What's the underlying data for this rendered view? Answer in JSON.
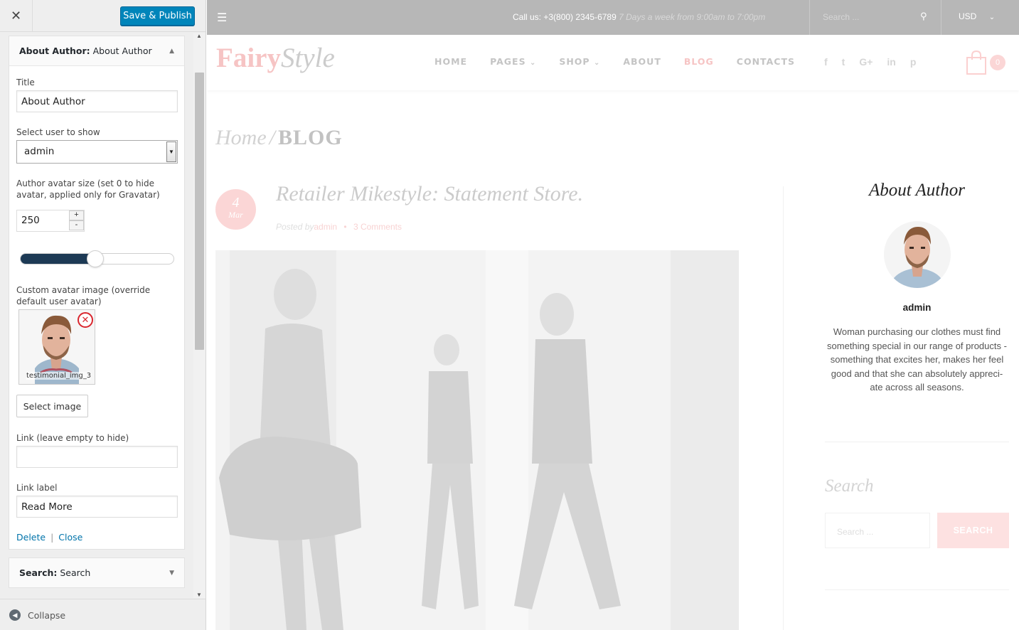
{
  "customizer": {
    "close_icon": "close-icon",
    "publish_label": "Save & Publish",
    "widget_author": {
      "title_bold": "About Author:",
      "title_rest": " About Author",
      "title_field_label": "Title",
      "title_field_value": "About Author",
      "user_label": "Select user to show",
      "user_value": "admin",
      "avatar_size_label": "Author avatar size (set 0 to hide avatar, applied only for Gravatar)",
      "avatar_size_value": "250",
      "stepper_plus": "+",
      "stepper_minus": "-",
      "slider_level": 0.42,
      "custom_avatar_label": "Custom avatar image (override default user avatar)",
      "image_filename": "testimonial_img_3",
      "select_image_label": "Select image",
      "link_label": "Link (leave empty to hide)",
      "link_value": "",
      "link_label_label": "Link label",
      "link_label_value": "Read More",
      "delete_label": "Delete",
      "separator": "|",
      "close_label": "Close"
    },
    "widget_search": {
      "title_bold": "Search:",
      "title_rest": " Search"
    },
    "collapse_label": "Collapse"
  },
  "site": {
    "call_us": "Call us: +3(800) 2345-6789",
    "hours": "7 Days a week from 9:00am to 7:00pm",
    "search_placeholder": "Search ...",
    "currency": "USD",
    "logo_part1": "Fairy",
    "logo_part2": "Style",
    "nav": [
      "HOME",
      "PAGES",
      "SHOP",
      "ABOUT",
      "BLOG",
      "CONTACTS"
    ],
    "nav_dropdown_marker": "⌄",
    "social": [
      "f",
      "t",
      "G+",
      "in",
      "p"
    ],
    "cart_count": "0",
    "breadcrumb_home": "Home",
    "breadcrumb_sep": "/",
    "breadcrumb_current": "BLOG",
    "post": {
      "day": "4",
      "month": "Mar",
      "title": "Retailer Mikestyle: Statement Store.",
      "posted_by": "Posted by",
      "author": "admin",
      "bullet": "•",
      "comments": "3 Comments"
    },
    "about_author": {
      "title": "About Author",
      "name": "admin",
      "bio": "Woman purchasing our clothes must find something special in our range of products - something that excites her, makes her feel good and that she can absolutely appreci-ate across all seasons."
    },
    "search_widget": {
      "title": "Search",
      "placeholder": "Search ...",
      "button": "SEARCH"
    }
  },
  "colors": {
    "publish_blue": "#0085ba",
    "brand_pink": "#f6c4c4",
    "topbar_gray": "#b7b7b7"
  }
}
